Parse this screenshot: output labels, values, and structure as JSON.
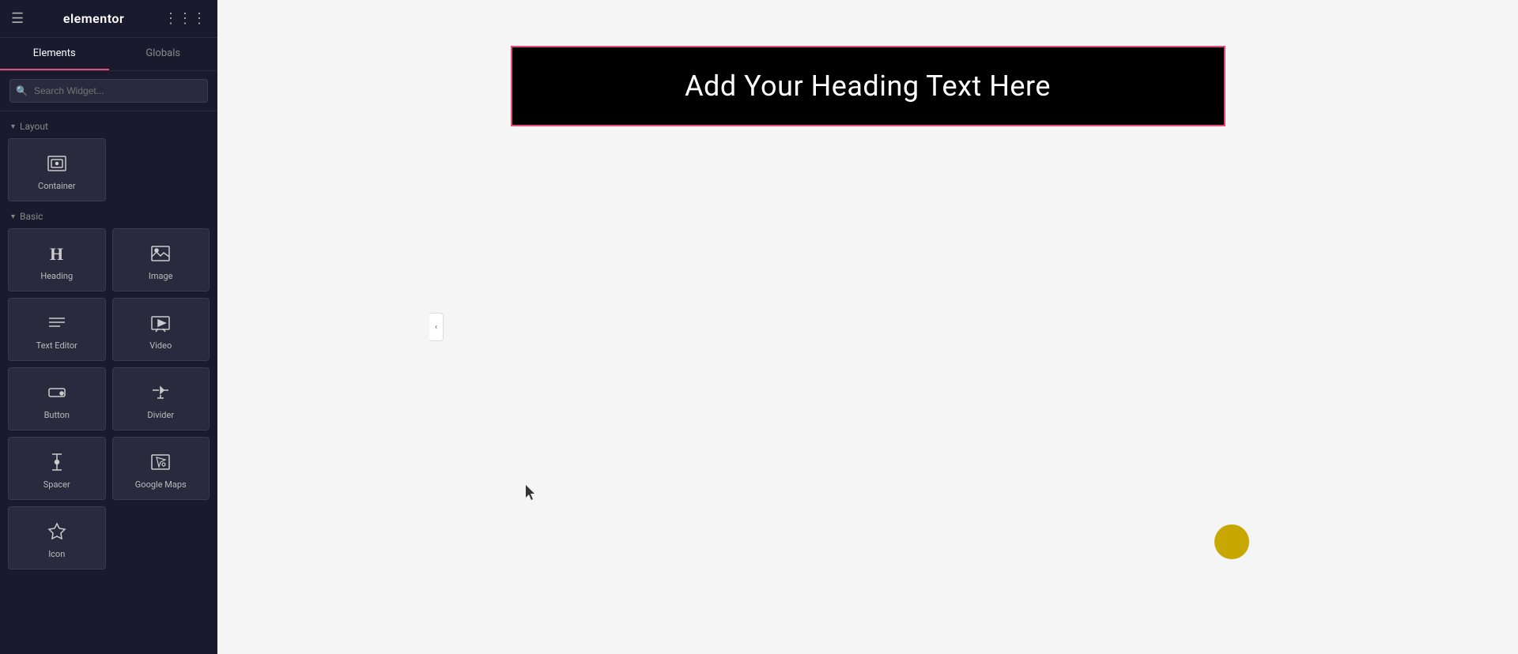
{
  "header": {
    "logo": "elementor",
    "menu_icon": "☰",
    "dots_icon": "⋮⋮⋮"
  },
  "tabs": [
    {
      "id": "elements",
      "label": "Elements",
      "active": true
    },
    {
      "id": "globals",
      "label": "Globals",
      "active": false
    }
  ],
  "search": {
    "placeholder": "Search Widget..."
  },
  "sections": [
    {
      "id": "layout",
      "label": "Layout",
      "widgets": [
        {
          "id": "container",
          "label": "Container",
          "icon": "container"
        }
      ]
    },
    {
      "id": "basic",
      "label": "Basic",
      "widgets": [
        {
          "id": "heading",
          "label": "Heading",
          "icon": "heading"
        },
        {
          "id": "image",
          "label": "Image",
          "icon": "image"
        },
        {
          "id": "text-editor",
          "label": "Text Editor",
          "icon": "text-editor"
        },
        {
          "id": "video",
          "label": "Video",
          "icon": "video"
        },
        {
          "id": "button",
          "label": "Button",
          "icon": "button"
        },
        {
          "id": "divider",
          "label": "Divider",
          "icon": "divider"
        },
        {
          "id": "spacer",
          "label": "Spacer",
          "icon": "spacer"
        },
        {
          "id": "google-maps",
          "label": "Google Maps",
          "icon": "google-maps"
        },
        {
          "id": "icon",
          "label": "Icon",
          "icon": "icon"
        }
      ]
    }
  ],
  "canvas": {
    "heading_text": "Add Your Heading Text Here"
  },
  "collapse_btn": "‹"
}
